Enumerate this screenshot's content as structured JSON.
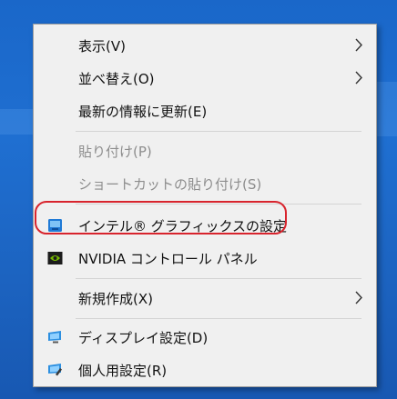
{
  "context_menu": {
    "items": [
      {
        "label": "表示(V)"
      },
      {
        "label": "並べ替え(O)"
      },
      {
        "label": "最新の情報に更新(E)"
      },
      {
        "label": "貼り付け(P)"
      },
      {
        "label": "ショートカットの貼り付け(S)"
      },
      {
        "label": "インテル® グラフィックスの設定",
        "icon": "intel-graphics-icon"
      },
      {
        "label": "NVIDIA コントロール パネル",
        "icon": "nvidia-icon"
      },
      {
        "label": "新規作成(X)"
      },
      {
        "label": "ディスプレイ設定(D)",
        "icon": "display-settings-icon"
      },
      {
        "label": "個人用設定(R)",
        "icon": "personalize-icon"
      }
    ],
    "highlight_color": "#d8242d",
    "disabled_text_color": "#8d8d8d"
  },
  "desktop": {
    "background_color": "#1f6fd1"
  }
}
